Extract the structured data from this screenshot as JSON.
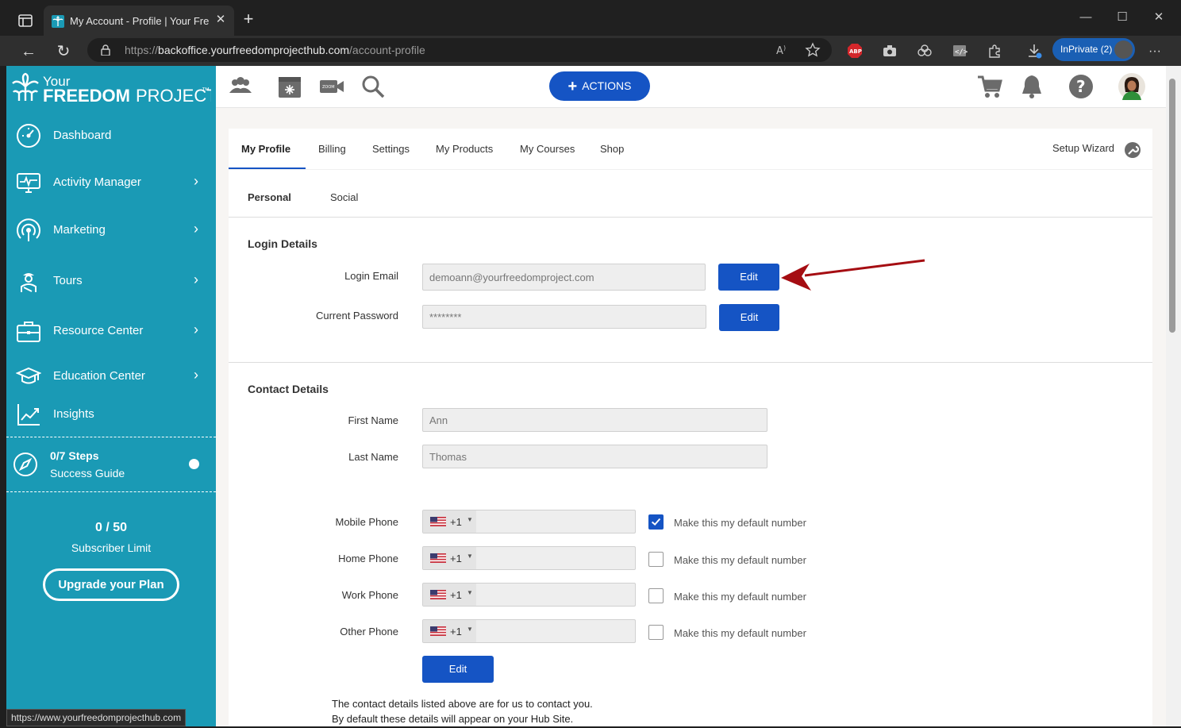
{
  "browser": {
    "tab_title": "My Account - Profile | Your Freed",
    "url_prefix": "https://",
    "url_domain": "backoffice.yourfreedomprojecthub.com",
    "url_path": "/account-profile",
    "inprivate_label": "InPrivate (2)",
    "status_url": "https://www.yourfreedomprojecthub.com"
  },
  "logo": {
    "line1": "Your",
    "line2": "FREEDOM",
    "line3": "PROJECT",
    "tm": "™"
  },
  "sidebar": {
    "items": [
      {
        "label": "Dashboard",
        "icon": "dashboard-gauge-icon"
      },
      {
        "label": "Activity Manager",
        "icon": "monitor-icon"
      },
      {
        "label": "Marketing",
        "icon": "broadcast-icon"
      },
      {
        "label": "Tours",
        "icon": "tour-guide-icon"
      },
      {
        "label": "Resource Center",
        "icon": "briefcase-icon"
      },
      {
        "label": "Education Center",
        "icon": "graduation-cap-icon"
      },
      {
        "label": "Insights",
        "icon": "chart-trend-icon"
      }
    ],
    "steps_count": "0/7",
    "steps_word": "Steps",
    "steps_subtitle": "Success Guide",
    "subscriber_count": "0 / 50",
    "subscriber_label": "Subscriber Limit",
    "upgrade_label": "Upgrade your Plan"
  },
  "topbar": {
    "actions_label": "ACTIONS",
    "icons": [
      "people-icon",
      "calendar-icon",
      "zoom-video-icon",
      "search-icon",
      "cart-icon",
      "bell-icon",
      "help-icon",
      "avatar"
    ]
  },
  "profile_tabs": [
    "My Profile",
    "Billing",
    "Settings",
    "My Products",
    "My Courses",
    "Shop"
  ],
  "setup_wizard_label": "Setup Wizard",
  "sub_tabs": [
    "Personal",
    "Social"
  ],
  "login_details": {
    "title": "Login Details",
    "email_label": "Login Email",
    "email_value": "demoann@yourfreedomproject.com",
    "password_label": "Current Password",
    "password_value": "********",
    "edit_label": "Edit"
  },
  "contact_details": {
    "title": "Contact Details",
    "first_name_label": "First Name",
    "first_name_value": "Ann",
    "last_name_label": "Last Name",
    "last_name_value": "Thomas",
    "phones": [
      {
        "label": "Mobile Phone",
        "code": "+1",
        "default_checked": true
      },
      {
        "label": "Home Phone",
        "code": "+1",
        "default_checked": false
      },
      {
        "label": "Work Phone",
        "code": "+1",
        "default_checked": false
      },
      {
        "label": "Other Phone",
        "code": "+1",
        "default_checked": false
      }
    ],
    "default_number_label": "Make this my default number",
    "edit_label": "Edit",
    "note_line1": "The contact details listed above are for us to contact you.",
    "note_line2": "By default these details will appear on your Hub Site."
  },
  "colors": {
    "sidebar": "#1a9ab5",
    "primary": "#1554c4",
    "annotation_arrow": "#a50d12"
  }
}
